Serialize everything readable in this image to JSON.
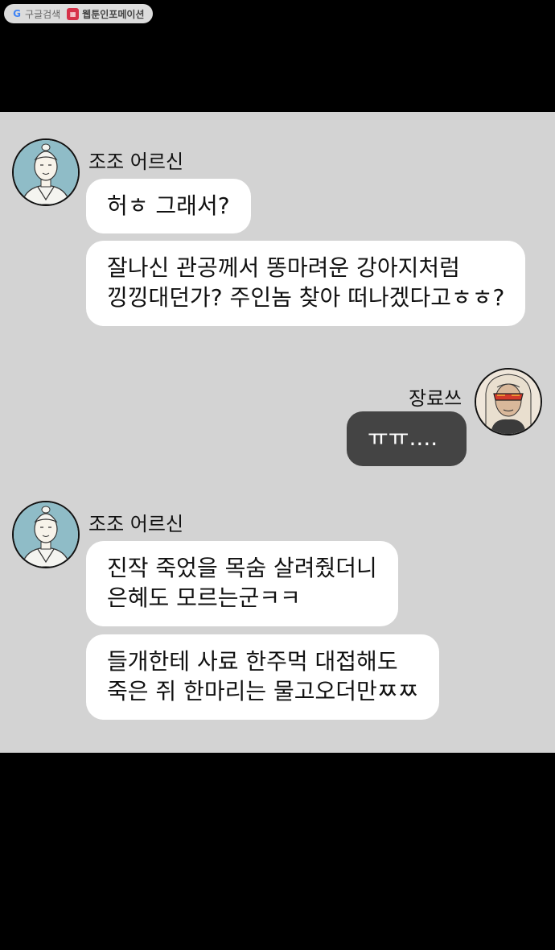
{
  "badge": {
    "google_label": "구글검색",
    "webtoon_label": "웹툰인포메이션"
  },
  "chat": {
    "block1": {
      "sender": "조조 어르신",
      "messages": [
        {
          "lines": [
            "허ㅎ 그래서?"
          ]
        },
        {
          "lines": [
            "잘나신 관공께서 똥마려운 강아지처럼",
            "낑낑대던가? 주인놈 찾아 떠나겠다고ㅎㅎ?"
          ]
        }
      ]
    },
    "block2": {
      "sender": "장료쓰",
      "messages": [
        {
          "lines": [
            "ㅠㅠ...."
          ]
        }
      ]
    },
    "block3": {
      "sender": "조조 어르신",
      "messages": [
        {
          "lines": [
            "진작 죽었을 목숨 살려줬더니",
            "은혜도 모르는군ㅋㅋ"
          ]
        },
        {
          "lines": [
            "들개한테 사료 한주먹 대접해도",
            "죽은 쥐 한마리는 물고오더만ㅉㅉ"
          ]
        }
      ]
    }
  }
}
